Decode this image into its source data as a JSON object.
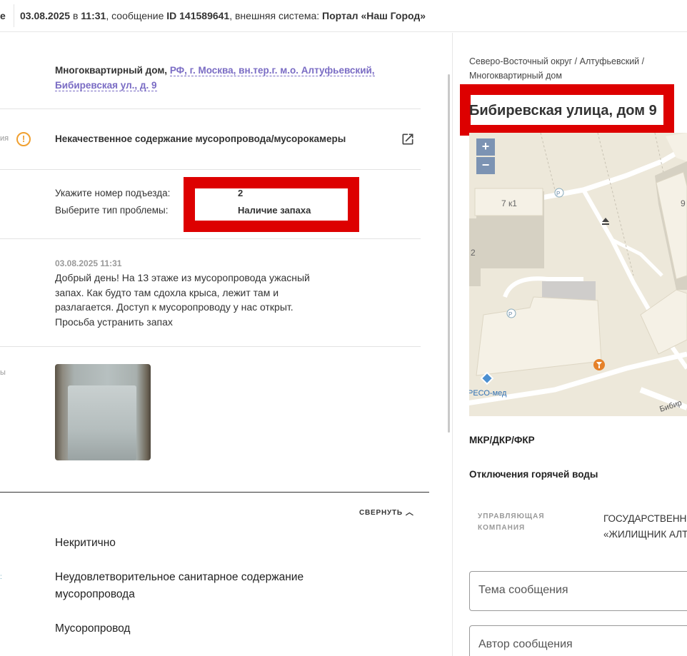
{
  "header": {
    "edge_char": "е",
    "datetime": "03.08.2025",
    "in_word": "в",
    "time": "11:31",
    "message_word": ", сообщение",
    "message_id": "ID 141589641",
    "external_word": ", внешняя система:",
    "system_name": "Портал «Наш Город»"
  },
  "address": {
    "prefix": "Многоквартирный дом,",
    "link_text": "РФ, г. Москва, вн.тер.г. м.о. Алтуфьевский, Бибиревская ул., д. 9"
  },
  "problem": {
    "cut_label": "ия",
    "title": "Некачественное содержание мусоропровода/мусорокамеры"
  },
  "questions": [
    {
      "label": "Укажите номер подъезда:",
      "value": "2"
    },
    {
      "label": "Выберите тип проблемы:",
      "value": "Наличие запаха"
    }
  ],
  "message": {
    "date": "03.08.2025 11:31",
    "text": "Добрый день! На 13 этаже из мусоропровода ужасный запах. Как будто там сдохла крыса, лежит там и разлагается. Доступ к мусоропроводу у нас открыт. Просьба устранить запах"
  },
  "photo_cut_label": "ы",
  "details": {
    "collapse_label": "СВЕРНУТЬ",
    "criticality": "Некритично",
    "category": "Неудовлетворительное санитарное содержание мусоропровода",
    "object": "Мусоропровод",
    "cut_dot": ":"
  },
  "right": {
    "breadcrumb_line1": "Северо-Восточный округ / Алтуфьевский /",
    "breadcrumb_line2": "Многоквартирный дом",
    "title": "Бибиревская улица, дом 9",
    "map": {
      "zoom_in": "+",
      "zoom_out": "−",
      "label_7k1": "7 к1",
      "label_9": "9",
      "label_2": "2",
      "label_p1": "P",
      "label_p2": "P",
      "label_reso": "РЕСО-мед",
      "label_street": "Бибир"
    },
    "section_mkr": "МКР/ДКР/ФКР",
    "section_hotwater": "Отключения горячей воды",
    "uk_label_line1": "УПРАВЛЯЮЩАЯ",
    "uk_label_line2": "КОМПАНИЯ",
    "uk_value_line1": "ГОСУДАРСТВЕННОЕ",
    "uk_value_line2": "«ЖИЛИЩНИК АЛТ",
    "field_subject_placeholder": "Тема сообщения",
    "field_author_placeholder": "Автор сообщения"
  }
}
